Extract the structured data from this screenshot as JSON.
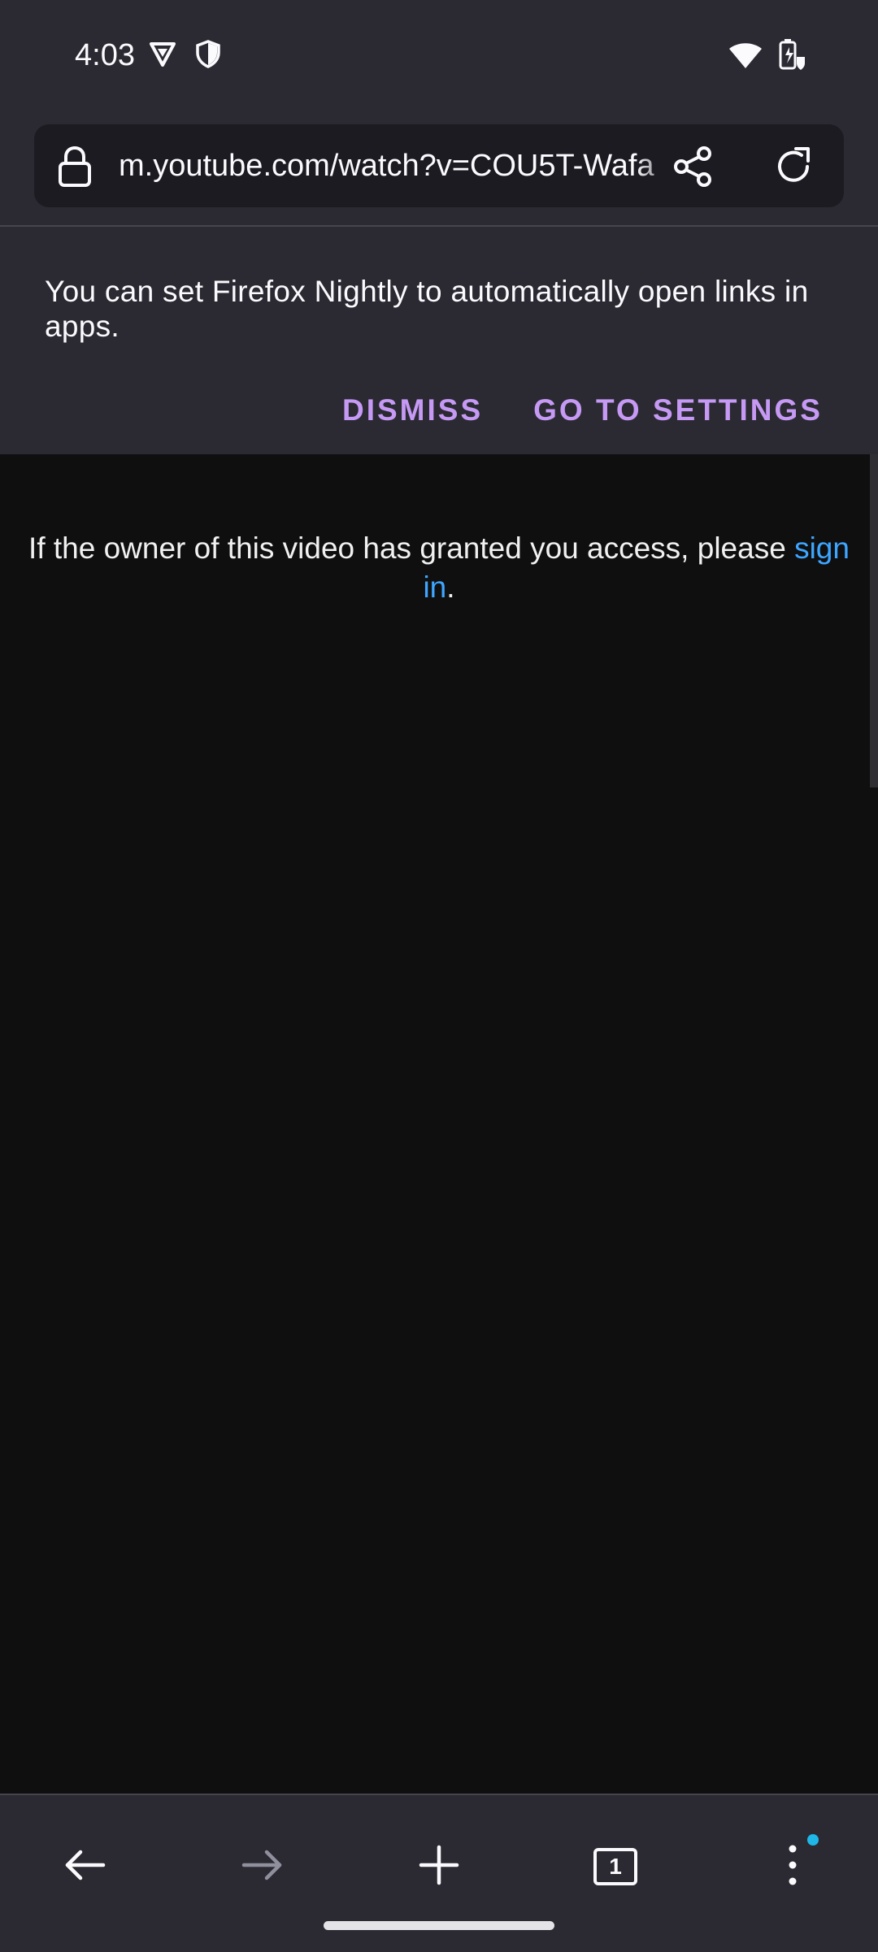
{
  "status_bar": {
    "time": "4:03",
    "left_icons": [
      "vpn-badge-icon",
      "shield-icon"
    ],
    "right_icons": [
      "wifi-icon",
      "battery-icon"
    ]
  },
  "url_bar": {
    "url": "m.youtube.com/watch?v=COU5T-Wafa",
    "icons": [
      "lock-icon",
      "share-icon",
      "reload-icon"
    ]
  },
  "banner": {
    "message": "You can set Firefox Nightly to automatically open links in apps.",
    "dismiss_label": "DISMISS",
    "settings_label": "GO TO SETTINGS"
  },
  "page": {
    "notice_prefix": "If the owner of this video has granted you access, please ",
    "sign_in_link": "sign in",
    "notice_suffix": "."
  },
  "bottom_toolbar": {
    "tab_count": "1",
    "icons": [
      "back-arrow-icon",
      "forward-arrow-icon",
      "new-tab-icon",
      "tabs-counter-icon",
      "menu-icon"
    ]
  },
  "colors": {
    "toolbar_bg": "#2b2a33",
    "page_bg": "#0f0f10",
    "accent_purple": "#c69af4",
    "link_blue": "#3ea6ff",
    "badge_blue": "#1fb7e8"
  }
}
